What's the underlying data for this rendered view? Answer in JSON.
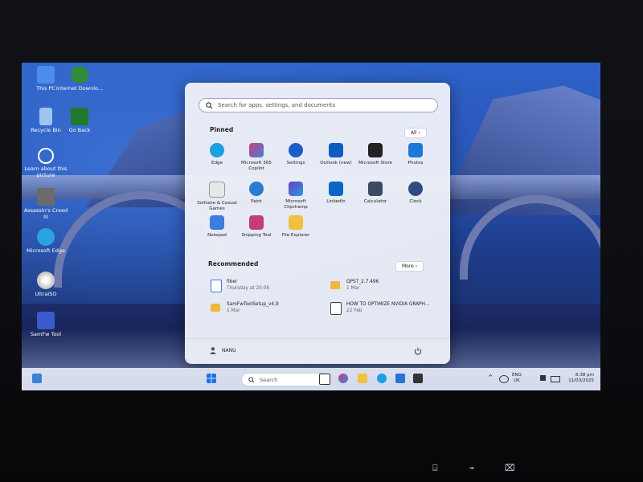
{
  "desktop": {
    "icons": [
      {
        "label": "This PC",
        "icon": "this-pc-icon",
        "color": "#4a8ee8"
      },
      {
        "label": "Internet Downlo...",
        "icon": "internet-download-manager-icon",
        "color": "#2e8c3a"
      },
      {
        "label": "Recycle Bin",
        "icon": "recycle-bin-icon",
        "color": "#9ec4f2"
      },
      {
        "label": "Go Back",
        "icon": "go-back-icon",
        "color": "#1f7a2e"
      },
      {
        "label": "Learn about this picture",
        "icon": "learn-about-picture-icon",
        "color": "#ffffff"
      },
      {
        "label": "Assassin's Creed III",
        "icon": "assassins-creed-icon",
        "color": "#6b6b6b"
      },
      {
        "label": "Microsoft Edge",
        "icon": "edge-icon",
        "color": "#2aa3e0"
      },
      {
        "label": "UltraISO",
        "icon": "ultraiso-icon",
        "color": "#e0e0e0"
      },
      {
        "label": "SamFw Tool",
        "icon": "samfw-tool-icon",
        "color": "#3a5bcc"
      }
    ]
  },
  "start_menu": {
    "search_placeholder": "Search for apps, settings, and documents",
    "pinned_title": "Pinned",
    "all_button": "All  ›",
    "pinned_apps": [
      {
        "label": "Edge",
        "icon": "edge-icon",
        "color": "#1ba1e2"
      },
      {
        "label": "Microsoft 365 Copilot",
        "icon": "copilot-icon",
        "color": "#c2417a"
      },
      {
        "label": "Settings",
        "icon": "settings-gear-icon",
        "color": "#1a5ec8"
      },
      {
        "label": "Outlook (new)",
        "icon": "outlook-icon",
        "color": "#0f5cc0"
      },
      {
        "label": "Microsoft Store",
        "icon": "store-icon",
        "color": "#222222"
      },
      {
        "label": "Photos",
        "icon": "photos-icon",
        "color": "#1b7ad6"
      },
      {
        "label": "Solitaire & Casual Games",
        "icon": "solitaire-icon",
        "color": "#e8e8e8"
      },
      {
        "label": "Paint",
        "icon": "paint-icon",
        "color": "#2a7bd1"
      },
      {
        "label": "Microsoft Clipchamp",
        "icon": "clipchamp-icon",
        "color": "#6a3bc3"
      },
      {
        "label": "LinkedIn",
        "icon": "linkedin-icon",
        "color": "#0a66c2"
      },
      {
        "label": "Calculator",
        "icon": "calculator-icon",
        "color": "#3b4a63"
      },
      {
        "label": "Clock",
        "icon": "clock-icon",
        "color": "#314a80"
      },
      {
        "label": "Notepad",
        "icon": "notepad-icon",
        "color": "#3e7de0"
      },
      {
        "label": "Snipping Tool",
        "icon": "snipping-tool-icon",
        "color": "#c43c7a"
      },
      {
        "label": "File Explorer",
        "icon": "file-explorer-icon",
        "color": "#f0c040"
      }
    ],
    "recommended_title": "Recommended",
    "more_button": "More  ›",
    "recommended": [
      {
        "name": "fiber",
        "time": "Thursday at 20:06",
        "icon": "document-icon",
        "color": "#3b7be0"
      },
      {
        "name": "QPST_2.7.496",
        "time": "1 Mar",
        "icon": "folder-icon",
        "color": "#f0b840"
      },
      {
        "name": "SamFwToolSetup_v4.9",
        "time": "1 Mar",
        "icon": "folder-icon",
        "color": "#f0b840"
      },
      {
        "name": "HOW TO OPTIMIZE NVIDIA GRAPH...",
        "time": "22 Feb",
        "icon": "video-icon",
        "color": "#2a2a2a"
      }
    ],
    "user_name": "NANU",
    "power_icon": "power-icon"
  },
  "taskbar": {
    "search_label": "Search",
    "apps": [
      {
        "icon": "widgets-icon",
        "color": "#3b82d8"
      },
      {
        "icon": "start-icon",
        "color": "#1a73e8"
      },
      {
        "icon": "task-view-icon",
        "color": "#333333"
      },
      {
        "icon": "copilot-icon",
        "color": "#c2417a"
      },
      {
        "icon": "file-explorer-icon",
        "color": "#f0c040"
      },
      {
        "icon": "edge-icon",
        "color": "#1ba1e2"
      },
      {
        "icon": "store-icon",
        "color": "#2a72d0"
      },
      {
        "icon": "terminal-icon",
        "color": "#333333"
      }
    ],
    "lang_top": "ENG",
    "lang_bottom": "UK",
    "time": "8:38 pm",
    "date": "11/03/2025"
  }
}
